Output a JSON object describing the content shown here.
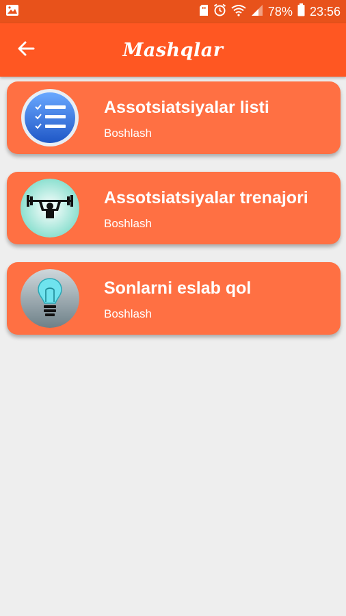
{
  "status_bar": {
    "battery": "78%",
    "time": "23:56",
    "icons": [
      "gallery-icon",
      "sd-card-icon",
      "alarm-icon",
      "wifi-icon",
      "signal-icon",
      "battery-icon"
    ]
  },
  "app_bar": {
    "title": "Mashqlar",
    "back_icon": "arrow-left-icon"
  },
  "colors": {
    "status_bar": "#e8521b",
    "app_bar": "#ff5722",
    "card": "#ff7043",
    "background": "#eeeeee"
  },
  "exercises": [
    {
      "title": "Assotsiatsiyalar listi",
      "action": "Boshlash",
      "icon": "checklist-icon"
    },
    {
      "title": "Assotsiatsiyalar trenajori",
      "action": "Boshlash",
      "icon": "weightlifter-icon"
    },
    {
      "title": "Sonlarni eslab qol",
      "action": "Boshlash",
      "icon": "lightbulb-icon"
    }
  ]
}
